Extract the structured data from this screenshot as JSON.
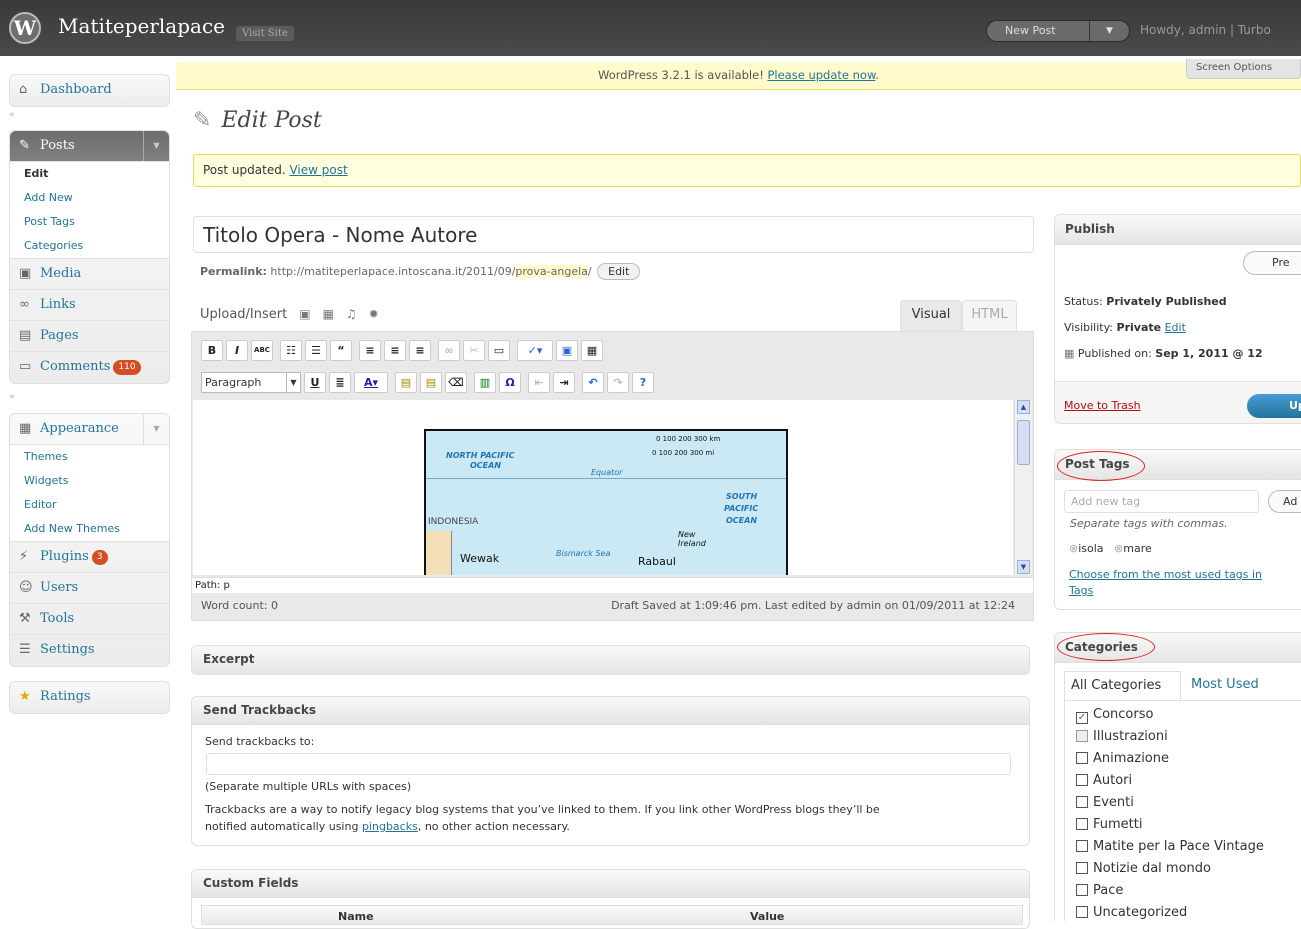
{
  "header": {
    "site_name": "Matiteperlapace",
    "visit_site": "Visit Site",
    "new_post": "New Post",
    "howdy": "Howdy, admin | Turbo"
  },
  "nag": {
    "text": "WordPress 3.2.1 is available! ",
    "link": "Please update now",
    "tail": "."
  },
  "screen_options": "Screen Options",
  "sidebar": {
    "dashboard": "Dashboard",
    "posts": "Posts",
    "posts_sub": [
      "Edit",
      "Add New",
      "Post Tags",
      "Categories"
    ],
    "media": "Media",
    "links": "Links",
    "pages": "Pages",
    "comments": "Comments",
    "comments_count": "110",
    "appearance": "Appearance",
    "appearance_sub": [
      "Themes",
      "Widgets",
      "Editor",
      "Add New Themes"
    ],
    "plugins": "Plugins",
    "plugins_count": "3",
    "users": "Users",
    "tools": "Tools",
    "settings": "Settings",
    "ratings": "Ratings"
  },
  "page_title": "Edit Post",
  "message": {
    "text": "Post updated. ",
    "link": "View post"
  },
  "post": {
    "title": "Titolo Opera -  Nome Autore",
    "permalink_label": "Permalink:",
    "permalink_url": "http://matiteperlapace.intoscana.it/2011/09/",
    "permalink_slug": "prova-angela",
    "permalink_tail": "/",
    "edit_button": "Edit"
  },
  "editor": {
    "upload_insert": "Upload/Insert",
    "tab_visual": "Visual",
    "tab_html": "HTML",
    "format_select": "Paragraph",
    "path": "Path: p",
    "word_count": "Word count: 0",
    "draft_saved": "Draft Saved at 1:09:46 pm. Last edited by admin on 01/09/2011 at 12:24"
  },
  "map": {
    "north_pacific": "NORTH PACIFIC",
    "ocean": "OCEAN",
    "equator": "Equator",
    "south_pacific": "SOUTH",
    "pacific": "PACIFIC",
    "ocean2": "OCEAN",
    "indonesia": "INDONESIA",
    "wewak": "Wewak",
    "bismarck": "Bismarck Sea",
    "rabaul": "Rabaul",
    "new_ireland": "New Ireland",
    "scale_km": "0  100 200 300 km",
    "scale_mi": "0    100   200   300 mi"
  },
  "excerpt": {
    "title": "Excerpt"
  },
  "trackbacks": {
    "title": "Send Trackbacks",
    "label": "Send trackbacks to:",
    "hint": "(Separate multiple URLs with spaces)",
    "desc_1": "Trackbacks are a way to notify legacy blog systems that you’ve linked to them. If you link other WordPress blogs they’ll be",
    "desc_2a": "notified automatically using ",
    "desc_link": "pingbacks",
    "desc_2b": ", no other action necessary."
  },
  "custom_fields": {
    "title": "Custom Fields",
    "col_name": "Name",
    "col_value": "Value"
  },
  "publish": {
    "title": "Publish",
    "preview": "Pre",
    "status_label": "Status: ",
    "status_value": "Privately Published",
    "visibility_label": "Visibility: ",
    "visibility_value": "Private",
    "visibility_edit": "Edit",
    "published_label": "Published on: ",
    "published_value": "Sep 1, 2011 @ 12",
    "trash": "Move to Trash",
    "update": "Up"
  },
  "post_tags": {
    "title": "Post Tags",
    "placeholder": "Add new tag",
    "add": "Ad",
    "hint": "Separate tags with commas.",
    "tags": [
      "isola",
      "mare"
    ],
    "choose": "Choose from the most used tags in",
    "choose_2": "Tags"
  },
  "categories": {
    "title": "Categories",
    "tab_all": "All Categories",
    "tab_most": "Most Used",
    "items": [
      {
        "label": "Concorso",
        "checked": true
      },
      {
        "label": "Illustrazioni",
        "checked": false
      },
      {
        "label": "Animazione",
        "checked": false
      },
      {
        "label": "Autori",
        "checked": false
      },
      {
        "label": "Eventi",
        "checked": false
      },
      {
        "label": "Fumetti",
        "checked": false
      },
      {
        "label": "Matite per la Pace Vintage",
        "checked": false
      },
      {
        "label": "Notizie dal mondo",
        "checked": false
      },
      {
        "label": "Pace",
        "checked": false
      },
      {
        "label": "Uncategorized",
        "checked": false
      }
    ]
  }
}
